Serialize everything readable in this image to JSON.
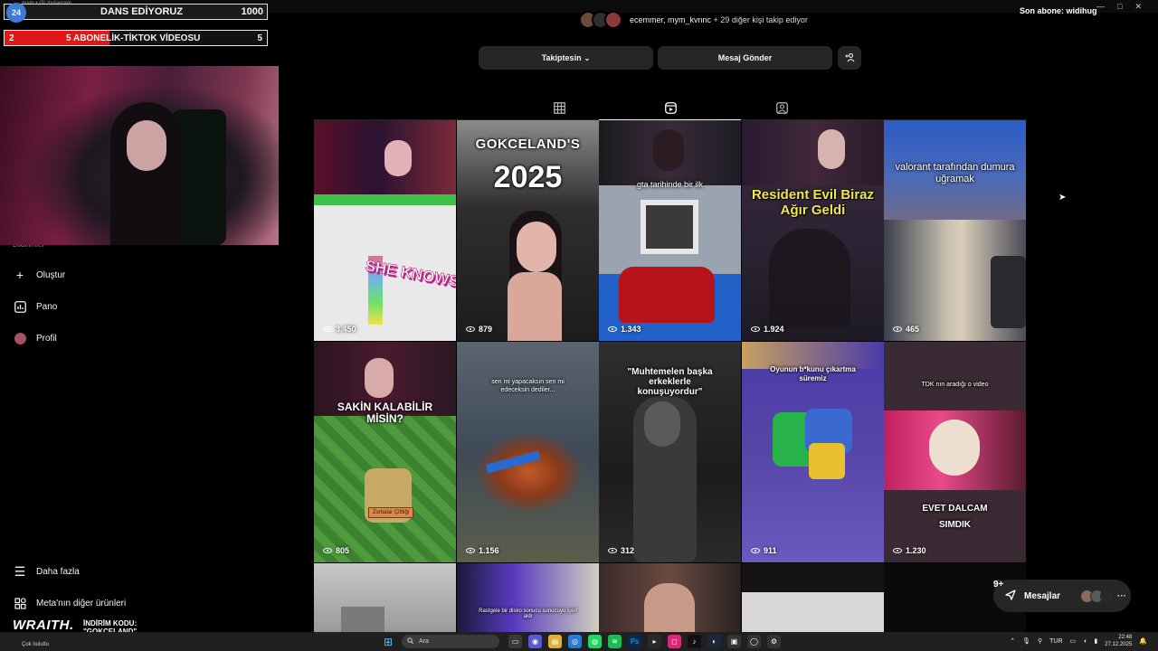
{
  "window": {
    "title": "gram • (9) Instagram"
  },
  "overlays": {
    "goal1": {
      "badge": "24",
      "label": "DANS EDİYORUZ",
      "value": "1000"
    },
    "goal2": {
      "low": "2",
      "label": "5 ABONELİK-TİKTOK VİDEOSU",
      "high": "5",
      "progress_fraction": 0.4,
      "fill_color": "#e01818"
    },
    "sub_ticker": "Son abone: widihug",
    "sponsor_brand": "WRAITH.",
    "sponsor_line1": "İNDİRİM KODU:",
    "sponsor_line2": "\"GOKCELAND\""
  },
  "sidebar": {
    "partial_item": "Bildirimler",
    "items": [
      {
        "label": "Oluştur",
        "icon": "plus-icon"
      },
      {
        "label": "Pano",
        "icon": "dashboard-icon"
      },
      {
        "label": "Profil",
        "icon": "avatar"
      }
    ],
    "bottom_items": [
      {
        "label": "Daha fazla",
        "icon": "menu-icon"
      },
      {
        "label": "Meta'nın diğer ürünleri",
        "icon": "apps-icon"
      }
    ]
  },
  "profile": {
    "followed_by": "ecemmer, mym_kvnnc",
    "followed_by_rest": "+ 29 diğer kişi takip ediyor",
    "follow_button": "Takiptesin",
    "message_button": "Mesaj Gönder"
  },
  "tabs": [
    {
      "name": "posts",
      "icon": "grid-icon",
      "active": false
    },
    {
      "name": "reels",
      "icon": "reels-icon",
      "active": true
    },
    {
      "name": "tagged",
      "icon": "tagged-icon",
      "active": false
    }
  ],
  "reels": [
    {
      "views": "3.450",
      "caption": "SHE KNOWS",
      "bg": "#e9e9ea"
    },
    {
      "views": "879",
      "caption_top": "GOKCELAND'S",
      "caption_big": "2025",
      "bg": "#3a3a3a"
    },
    {
      "views": "1.343",
      "caption": "gta tarihinde bir ilk",
      "bg": "#9aa3b0"
    },
    {
      "views": "1.924",
      "caption": "Resident Evil Biraz Ağır Geldi",
      "bg": "#2c2433"
    },
    {
      "views": "465",
      "caption": "valorant tarafından dumura uğramak",
      "bg": "#4b5a8a"
    },
    {
      "views": "805",
      "caption": "SAKİN KALABİLİR MİSİN?",
      "sign": "Zorbalar Çiftliği",
      "bg": "#4f8f3c"
    },
    {
      "views": "1.156",
      "caption": "sen mi yapacaksın sen mi edeceksin dediler...",
      "bg": "#3f4a58"
    },
    {
      "views": "312",
      "caption": "\"Muhtemelen başka erkeklerle konuşuyordur\"",
      "bg": "#1e1e1e"
    },
    {
      "views": "911",
      "caption": "Oyunun b*kunu çıkartma süremiz",
      "bg": "#5646a8"
    },
    {
      "views": "1.230",
      "caption_top": "TDK nın aradığı o video",
      "caption": "EVET DALCAM SIMDIK",
      "bg": "#3b2a33"
    },
    {
      "views": "",
      "caption": "",
      "bg": "#a8a8a8"
    },
    {
      "views": "",
      "caption": "Rastgele bir disko sonucu sunucuyu içeri aldı",
      "bg": "#2a2a5a"
    },
    {
      "views": "",
      "caption": "",
      "bg": "#3a3030"
    },
    {
      "views": "",
      "caption": "",
      "bg": "#141414"
    },
    {
      "views": "",
      "caption": "",
      "bg": "#0a0a0a"
    }
  ],
  "messages": {
    "label": "Mesajlar",
    "badge": "9+"
  },
  "taskbar": {
    "weather": "Çok bulutlu",
    "search_placeholder": "Ara",
    "language": "TUR",
    "time": "22:48",
    "date": "27.12.2025"
  }
}
